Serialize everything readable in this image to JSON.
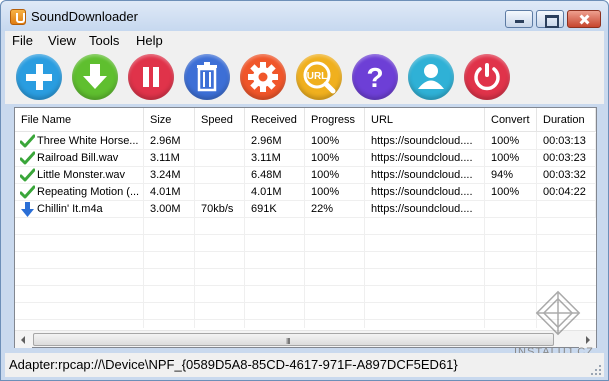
{
  "window": {
    "title": "SoundDownloader"
  },
  "menu": {
    "items": [
      "File",
      "View",
      "Tools",
      "Help"
    ]
  },
  "toolbar": {
    "buttons": [
      {
        "icon": "plus-icon",
        "color": "#2a9de0"
      },
      {
        "icon": "download-arrow-icon",
        "color": "#5fbf2f"
      },
      {
        "icon": "pause-icon",
        "color": "#e0334a"
      },
      {
        "icon": "trash-icon",
        "color": "#3d6fd6"
      },
      {
        "icon": "gear-icon",
        "color": "#f0562a"
      },
      {
        "icon": "url-search-icon",
        "color": "#f0b01e"
      },
      {
        "icon": "help-icon",
        "color": "#6d3fd6"
      },
      {
        "icon": "user-icon",
        "color": "#2fb1d6"
      },
      {
        "icon": "power-icon",
        "color": "#e0334a"
      }
    ],
    "url_label": "URL",
    "help_glyph": "?"
  },
  "table": {
    "columns": [
      "File Name",
      "Size",
      "Speed",
      "Received",
      "Progress",
      "URL",
      "Convert",
      "Duration"
    ],
    "rows": [
      {
        "status": "done",
        "name": "Three White Horse...",
        "size": "2.96M",
        "speed": "",
        "received": "2.96M",
        "progress": "100%",
        "url": "https://soundcloud....",
        "convert": "100%",
        "duration": "00:03:13"
      },
      {
        "status": "done",
        "name": "Railroad Bill.wav",
        "size": "3.11M",
        "speed": "",
        "received": "3.11M",
        "progress": "100%",
        "url": "https://soundcloud....",
        "convert": "100%",
        "duration": "00:03:23"
      },
      {
        "status": "done",
        "name": "Little Monster.wav",
        "size": "3.24M",
        "speed": "",
        "received": "6.48M",
        "progress": "100%",
        "url": "https://soundcloud....",
        "convert": "94%",
        "duration": "00:03:32"
      },
      {
        "status": "done",
        "name": "Repeating Motion (...",
        "size": "4.01M",
        "speed": "",
        "received": "4.01M",
        "progress": "100%",
        "url": "https://soundcloud....",
        "convert": "100%",
        "duration": "00:04:22"
      },
      {
        "status": "downloading",
        "name": "Chillin' It.m4a",
        "size": "3.00M",
        "speed": "70kb/s",
        "received": "691K",
        "progress": "22%",
        "url": "https://soundcloud....",
        "convert": "",
        "duration": ""
      }
    ]
  },
  "scrollbar": {
    "grip": "III"
  },
  "status": {
    "text": "Adapter:rpcap://\\Device\\NPF_{0589D5A8-85CD-4617-971F-A897DCF5ED61}"
  },
  "watermark": {
    "text": "INSTALUJ.CZ"
  }
}
